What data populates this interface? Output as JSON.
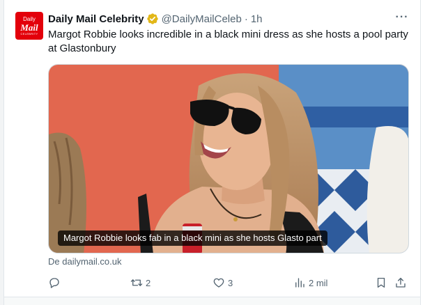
{
  "tweet": {
    "avatar": {
      "line1": "Daily",
      "line2": "Mail",
      "line3": "CELEBRITY",
      "color": "#e3000b"
    },
    "display_name": "Daily Mail Celebrity",
    "verified_icon": "gold-verified-badge-icon",
    "handle": "@DailyMailCeleb",
    "separator": "·",
    "time": "1h",
    "more_icon": "more-options-icon",
    "more_label": "···",
    "text": "Margot Robbie looks incredible in a black mini dress as she hosts a pool party at Glastonbury",
    "media": {
      "caption": "Margot Robbie looks fab in a black mini as she hosts Glasto part"
    },
    "source": "De dailymail.co.uk",
    "actions": {
      "reply": {
        "icon": "reply-icon",
        "count": ""
      },
      "retweet": {
        "icon": "retweet-icon",
        "count": "2"
      },
      "like": {
        "icon": "heart-icon",
        "count": "3"
      },
      "views": {
        "icon": "views-icon",
        "count": "2 mil"
      },
      "bookmark": {
        "icon": "bookmark-icon"
      },
      "share": {
        "icon": "share-icon"
      }
    }
  },
  "colors": {
    "text_primary": "#0f1419",
    "text_secondary": "#536471",
    "brand_red": "#e3000b",
    "verified_gold": "#e2b719",
    "border": "#cfd9de"
  }
}
